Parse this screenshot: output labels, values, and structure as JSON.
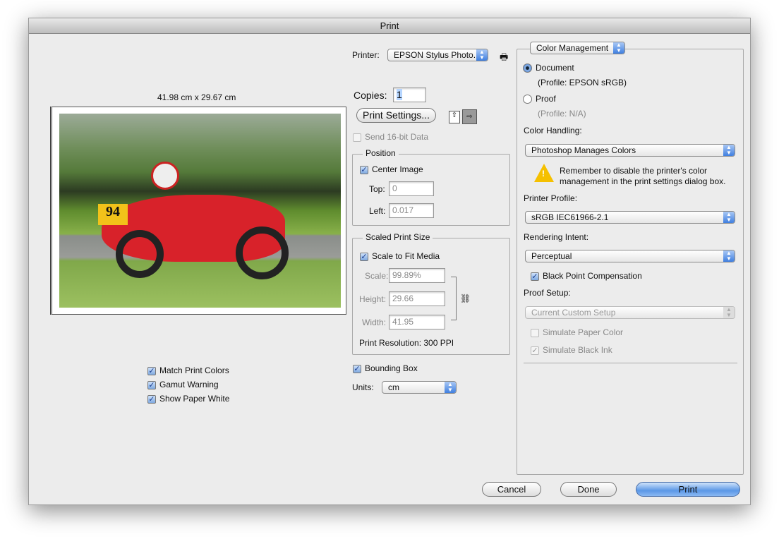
{
  "window": {
    "title": "Print"
  },
  "preview": {
    "dimensions": "41.98 cm x 29.67 cm"
  },
  "left_options": [
    {
      "label": "Match Print Colors",
      "checked": true
    },
    {
      "label": "Gamut Warning",
      "checked": true
    },
    {
      "label": "Show Paper White",
      "checked": true
    }
  ],
  "printer": {
    "label": "Printer:",
    "value": "EPSON Stylus Photo..."
  },
  "copies": {
    "label": "Copies:",
    "value": "1"
  },
  "print_settings_label": "Print Settings...",
  "send16": {
    "label": "Send 16-bit Data",
    "checked": false
  },
  "position": {
    "title": "Position",
    "center_label": "Center Image",
    "center_checked": true,
    "top_label": "Top:",
    "top_value": "0",
    "left_label": "Left:",
    "left_value": "0.017"
  },
  "scaled": {
    "title": "Scaled Print Size",
    "fit_label": "Scale to Fit Media",
    "fit_checked": true,
    "scale_label": "Scale:",
    "scale_value": "99.89%",
    "height_label": "Height:",
    "height_value": "29.66",
    "width_label": "Width:",
    "width_value": "41.95",
    "resolution": "Print Resolution: 300 PPI"
  },
  "bounding_box": {
    "label": "Bounding Box",
    "checked": true
  },
  "units": {
    "label": "Units:",
    "value": "cm"
  },
  "color": {
    "section": "Color Management",
    "document_label": "Document",
    "document_profile": "(Profile: EPSON  sRGB)",
    "proof_label": "Proof",
    "proof_profile": "(Profile: N/A)",
    "handling_label": "Color Handling:",
    "handling_value": "Photoshop Manages Colors",
    "warning": "Remember to disable the printer's color management in the print settings dialog box.",
    "profile_label": "Printer Profile:",
    "profile_value": "sRGB IEC61966-2.1",
    "intent_label": "Rendering Intent:",
    "intent_value": "Perceptual",
    "bpc_label": "Black Point Compensation",
    "bpc_checked": true,
    "proof_setup_label": "Proof Setup:",
    "proof_setup_value": "Current Custom Setup",
    "sim_paper": "Simulate Paper Color",
    "sim_ink": "Simulate Black Ink"
  },
  "buttons": {
    "cancel": "Cancel",
    "done": "Done",
    "print": "Print"
  },
  "accent": "#5a97e6"
}
